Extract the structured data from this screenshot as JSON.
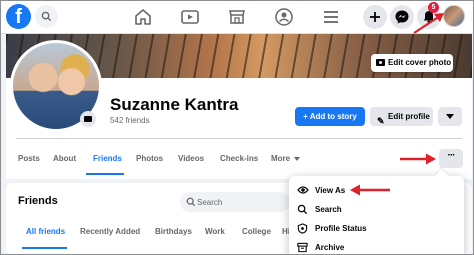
{
  "nav": {
    "logo_letter": "f",
    "notification_count": "5",
    "icons": [
      "search-icon",
      "home-icon",
      "watch-icon",
      "marketplace-icon",
      "groups-icon",
      "menu-icon",
      "create-icon",
      "messenger-icon",
      "bell-icon"
    ]
  },
  "cover": {
    "edit_cover_label": "Edit cover photo"
  },
  "profile": {
    "name": "Suzanne Kantra",
    "friends_count": "542 friends",
    "add_story_label": "+ Add to story",
    "edit_profile_label": "Edit profile"
  },
  "tabs": [
    "Posts",
    "About",
    "Friends",
    "Photos",
    "Videos",
    "Check-ins",
    "More"
  ],
  "active_tab": "Friends",
  "dots_label": "···",
  "friends_section": {
    "title": "Friends",
    "search_placeholder": "Search",
    "subtabs": [
      "All friends",
      "Recently Added",
      "Birthdays",
      "Work",
      "College",
      "Hi"
    ]
  },
  "menu": {
    "items": [
      {
        "label": "View As",
        "icon": "eye-icon"
      },
      {
        "label": "Search",
        "icon": "search-icon"
      },
      {
        "label": "Profile Status",
        "icon": "shield-icon"
      },
      {
        "label": "Archive",
        "icon": "archive-icon"
      }
    ]
  },
  "colors": {
    "brand": "#1877f2",
    "annotation": "#e0202a",
    "badge": "#e41e3f"
  }
}
